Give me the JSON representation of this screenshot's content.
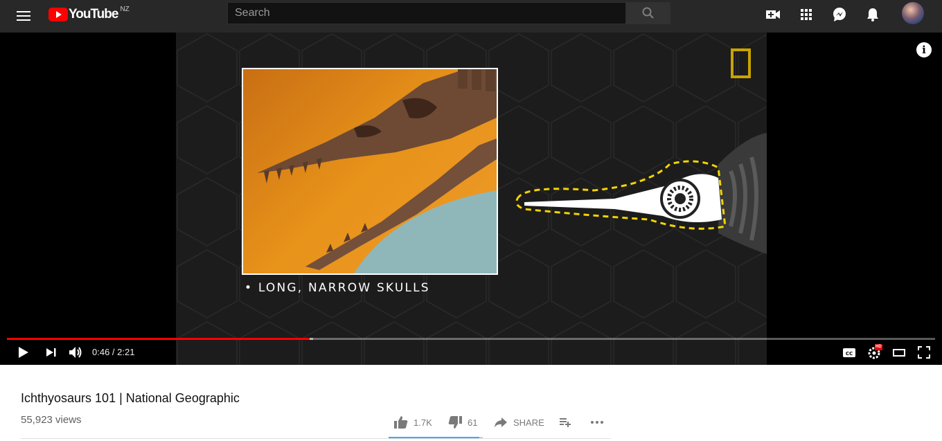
{
  "header": {
    "logo_text": "YouTube",
    "region": "NZ",
    "search_placeholder": "Search",
    "icons": [
      "menu-icon",
      "youtube-logo-icon",
      "search-icon",
      "create-video-icon",
      "apps-grid-icon",
      "messages-icon",
      "notifications-bell-icon",
      "account-avatar"
    ]
  },
  "player": {
    "overlay_caption": "• LONG, NARROW SKULLS",
    "current_time": "0:46",
    "duration": "2:21",
    "time_display": "0:46 / 2:21",
    "played_fraction": 0.326,
    "buffered_fraction": 0.33,
    "quality_badge": "HD",
    "controls": [
      "play-icon",
      "next-icon",
      "volume-icon",
      "captions-icon",
      "settings-icon",
      "theater-mode-icon",
      "fullscreen-icon",
      "info-icon"
    ],
    "brand_colors": {
      "progress": "#ff0000",
      "nat_geo_frame": "#c8a400"
    }
  },
  "video": {
    "title": "Ichthyosaurs 101 | National Geographic",
    "views": "55,923 views",
    "likes": "1.7K",
    "dislikes": "61",
    "share_label": "SHARE",
    "like_fraction": 0.965
  }
}
